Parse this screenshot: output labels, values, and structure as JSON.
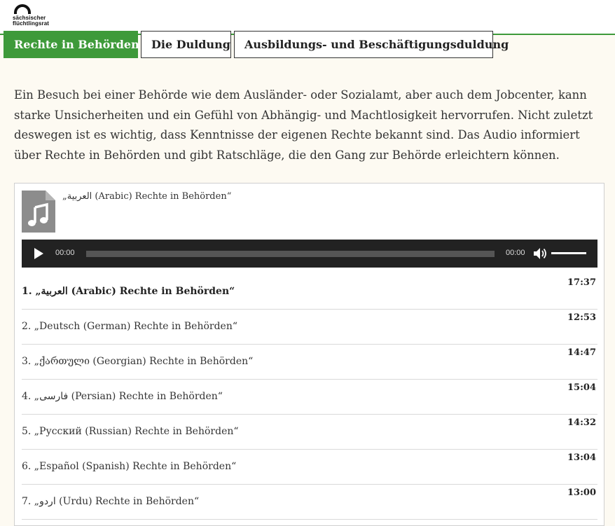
{
  "logo": {
    "line1": "sächsischer",
    "line2": "flüchtlingsrat"
  },
  "tabs": [
    {
      "label": "Rechte in Behörden",
      "active": true
    },
    {
      "label": "Die Duldung",
      "active": false
    },
    {
      "label": "Ausbildungs- und Beschäftigungsduldung",
      "active": false
    }
  ],
  "intro": "Ein Besuch bei einer Behörde wie dem Ausländer- oder Sozialamt, aber auch dem Jobcenter, kann starke Unsicherheiten und ein Gefühl von Abhängig- und Machtlosigkeit hervorrufen. Nicht zuletzt deswegen ist es wichtig, dass Kenntnisse der eigenen Rechte bekannt sind. Das Audio informiert über Rechte in Behörden und gibt Ratschläge, die den Gang zur Behörde erleichtern können.",
  "player": {
    "current_title": "„العربية (Arabic) Rechte in Behörden“",
    "current_time": "00:00",
    "duration": "00:00"
  },
  "tracks": [
    {
      "title": "1. „العربية (Arabic) Rechte in Behörden“",
      "length": "17:37"
    },
    {
      "title": "2. „Deutsch (German) Rechte in Behörden“",
      "length": "12:53"
    },
    {
      "title": "3. „ქართული (Georgian) Rechte in Behörden“",
      "length": "14:47"
    },
    {
      "title": "4. „فارسی (Persian) Rechte in Behörden“",
      "length": "15:04"
    },
    {
      "title": "5. „Русский (Russian) Rechte in Behörden“",
      "length": "14:32"
    },
    {
      "title": "6. „Español (Spanish) Rechte in Behörden“",
      "length": "13:04"
    },
    {
      "title": "7. „اردو (Urdu) Rechte in Behörden“",
      "length": "13:00"
    }
  ],
  "colors": {
    "accent": "#3e9a3a",
    "player_bg": "#222222"
  },
  "icons": [
    "music-file-icon",
    "play-icon",
    "volume-icon"
  ]
}
